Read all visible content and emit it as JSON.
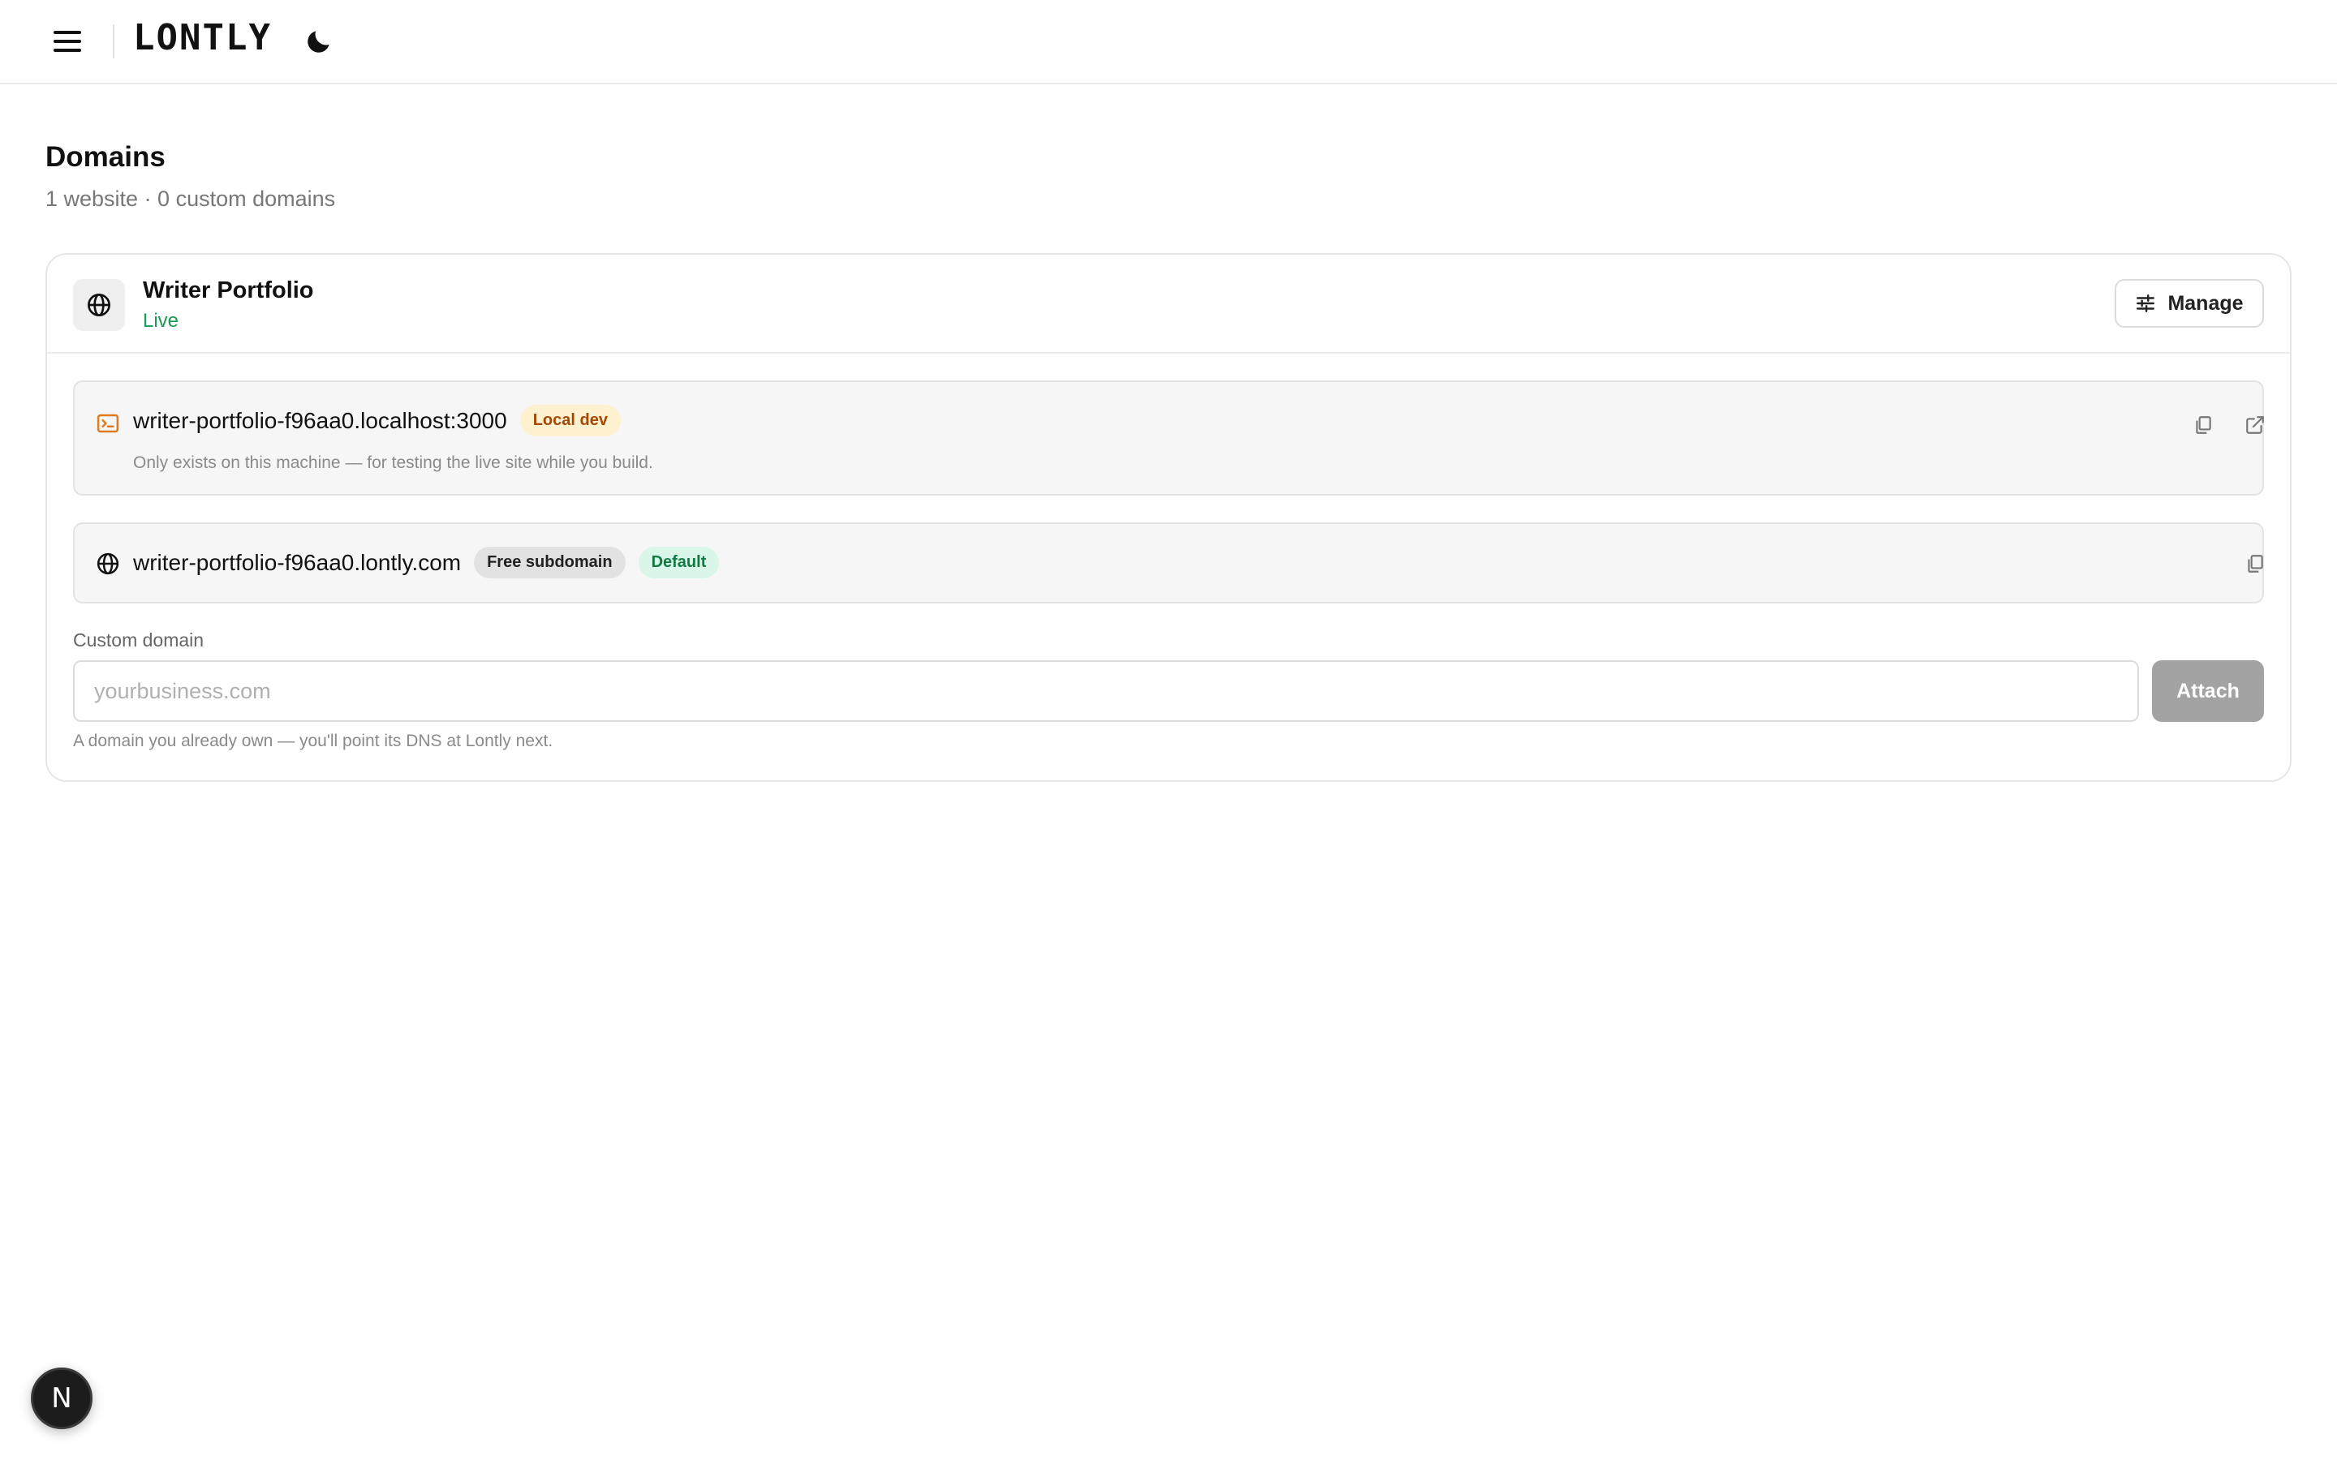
{
  "header": {
    "logo": "LONTLY",
    "menu_icon": "hamburger-menu-icon",
    "theme_icon": "moon-icon"
  },
  "page": {
    "title": "Domains",
    "subtitle": "1 website · 0 custom domains"
  },
  "site": {
    "name": "Writer Portfolio",
    "status": "Live",
    "status_color": "#1a9a53",
    "icon": "globe-icon",
    "manage_label": "Manage",
    "manage_icon": "sliders-icon"
  },
  "domains": [
    {
      "host": "writer-portfolio-f96aa0.localhost:3000",
      "icon": "terminal-icon",
      "badges": [
        "Local dev"
      ],
      "note": "Only exists on this machine — for testing the live site while you build.",
      "actions": [
        "copy-icon",
        "external-link-icon"
      ]
    },
    {
      "host": "writer-portfolio-f96aa0.lontly.com",
      "icon": "globe-icon",
      "badges": [
        "Free subdomain",
        "Default"
      ],
      "actions": [
        "copy-icon"
      ]
    }
  ],
  "custom_domain": {
    "label": "Custom domain",
    "placeholder": "yourbusiness.com",
    "value": "",
    "attach_label": "Attach",
    "hint": "A domain you already own — you'll point its DNS at Lontly next."
  },
  "dev_badge": {
    "letter": "N"
  },
  "colors": {
    "accent_green": "#1a9a53",
    "local_badge_bg": "#fdf1cf",
    "local_badge_text": "#a14a08",
    "terminal_icon": "#e07a1f",
    "attach_disabled": "#a3a3a3"
  }
}
